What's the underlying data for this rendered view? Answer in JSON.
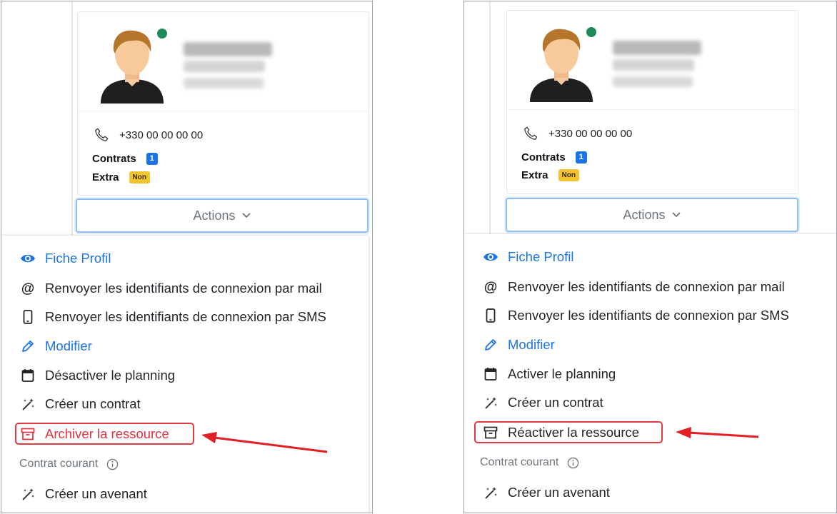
{
  "colors": {
    "accent": "#1a73e8",
    "danger": "#e0313e",
    "online": "#1f8a59",
    "badge_yellow": "#f4c430",
    "annotation": "#e31e24"
  },
  "left": {
    "card": {
      "phone": "+330 00 00 00 00",
      "contracts_label": "Contrats",
      "contracts_count": "1",
      "extra_label": "Extra",
      "extra_value": "Non"
    },
    "actions_label": "Actions",
    "menu": {
      "fiche": "Fiche Profil",
      "resend_mail": "Renvoyer les identifiants de connexion par mail",
      "resend_sms": "Renvoyer les identifiants de connexion par SMS",
      "edit": "Modifier",
      "planning": "Désactiver le planning",
      "create_contract": "Créer un contrat",
      "archive": "Archiver la ressource",
      "current_contract": "Contrat courant",
      "create_amendment": "Créer un avenant"
    }
  },
  "right": {
    "card": {
      "phone": "+330 00 00 00 00",
      "contracts_label": "Contrats",
      "contracts_count": "1",
      "extra_label": "Extra",
      "extra_value": "Non"
    },
    "actions_label": "Actions",
    "menu": {
      "fiche": "Fiche Profil",
      "resend_mail": "Renvoyer les identifiants de connexion par mail",
      "resend_sms": "Renvoyer les identifiants de connexion par SMS",
      "edit": "Modifier",
      "planning": "Activer le planning",
      "create_contract": "Créer un contrat",
      "archive": "Réactiver la ressource",
      "current_contract": "Contrat courant",
      "create_amendment": "Créer un avenant"
    }
  },
  "icons": [
    "eye-icon",
    "at-icon",
    "phone-device-icon",
    "pencil-icon",
    "calendar-icon",
    "magic-wand-icon",
    "archive-icon",
    "info-icon",
    "chevron-down-icon",
    "telephone-icon",
    "avatar",
    "arrow-annotation"
  ]
}
